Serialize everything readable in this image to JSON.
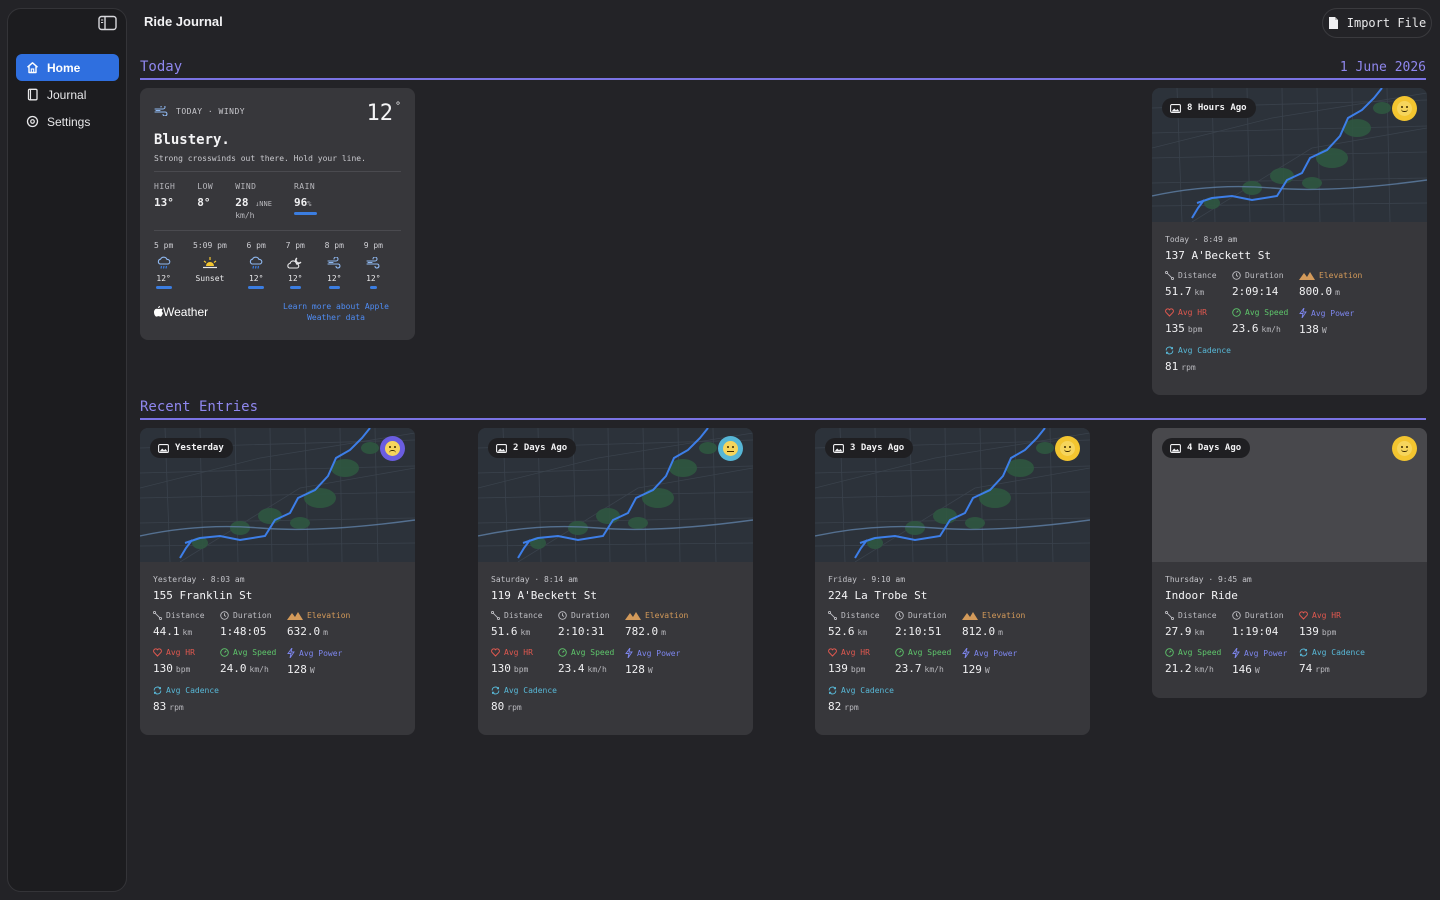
{
  "app": {
    "title": "Ride Journal",
    "import_label": "Import File"
  },
  "sidebar": {
    "items": [
      {
        "label": "Home",
        "icon": "house-icon",
        "active": true
      },
      {
        "label": "Journal",
        "icon": "book-icon",
        "active": false
      },
      {
        "label": "Settings",
        "icon": "gear-icon",
        "active": false
      }
    ]
  },
  "today": {
    "heading": "Today",
    "date": "1 June 2026"
  },
  "weather": {
    "label": "TODAY · WINDY",
    "temp": "12",
    "deg": "°",
    "headline": "Blustery.",
    "subtitle": "Strong crosswinds out there. Hold your line.",
    "stats": {
      "high_label": "HIGH",
      "high": "13°",
      "low_label": "LOW",
      "low": "8°",
      "wind_label": "WIND",
      "wind": "28",
      "wind_dir": "↓NNE",
      "wind_unit": "km/h",
      "rain_label": "RAIN",
      "rain": "96",
      "rain_unit": "%",
      "rain_fraction": 0.96
    },
    "hours": [
      {
        "time": "5 pm",
        "icon": "rain-icon",
        "value": "12°"
      },
      {
        "time": "5:09 pm",
        "icon": "sunset-icon",
        "value": "Sunset"
      },
      {
        "time": "6 pm",
        "icon": "rain-icon",
        "value": "12°"
      },
      {
        "time": "7 pm",
        "icon": "partly-cloudy-night-icon",
        "value": "12°"
      },
      {
        "time": "8 pm",
        "icon": "wind-icon",
        "value": "12°"
      },
      {
        "time": "9 pm",
        "icon": "wind-icon",
        "value": "12°"
      }
    ],
    "brand": "Weather",
    "link": "Learn more about Apple Weather data"
  },
  "today_ride": {
    "pill": "8 Hours Ago",
    "mood": "happy",
    "mood_color": "#f3c530",
    "date": "Today · 8:49 am",
    "title": "137 A'Beckett St",
    "metrics": [
      {
        "label": "Distance",
        "value": "51.7",
        "unit": "km",
        "kind": "grey"
      },
      {
        "label": "Duration",
        "value": "2:09:14",
        "unit": "",
        "kind": "grey"
      },
      {
        "label": "Elevation",
        "value": "800.0",
        "unit": "m",
        "kind": "elev"
      },
      {
        "label": "Avg HR",
        "value": "135",
        "unit": "bpm",
        "kind": "hr"
      },
      {
        "label": "Avg Speed",
        "value": "23.6",
        "unit": "km/h",
        "kind": "speed"
      },
      {
        "label": "Avg Power",
        "value": "138",
        "unit": "W",
        "kind": "power"
      },
      {
        "label": "Avg Cadence",
        "value": "81",
        "unit": "rpm",
        "kind": "cad"
      }
    ]
  },
  "recent": {
    "heading": "Recent Entries"
  },
  "entries": [
    {
      "pill": "Yesterday",
      "mood": "sad",
      "mood_color": "#6a5de0",
      "date": "Yesterday · 8:03 am",
      "title": "155 Franklin St",
      "metrics": [
        {
          "label": "Distance",
          "value": "44.1",
          "unit": "km",
          "kind": "grey"
        },
        {
          "label": "Duration",
          "value": "1:48:05",
          "unit": "",
          "kind": "grey"
        },
        {
          "label": "Elevation",
          "value": "632.0",
          "unit": "m",
          "kind": "elev"
        },
        {
          "label": "Avg HR",
          "value": "130",
          "unit": "bpm",
          "kind": "hr"
        },
        {
          "label": "Avg Speed",
          "value": "24.0",
          "unit": "km/h",
          "kind": "speed"
        },
        {
          "label": "Avg Power",
          "value": "128",
          "unit": "W",
          "kind": "power"
        },
        {
          "label": "Avg Cadence",
          "value": "83",
          "unit": "rpm",
          "kind": "cad"
        }
      ]
    },
    {
      "pill": "2 Days Ago",
      "mood": "neutral",
      "mood_color": "#56b6d6",
      "date": "Saturday · 8:14 am",
      "title": "119 A'Beckett St",
      "metrics": [
        {
          "label": "Distance",
          "value": "51.6",
          "unit": "km",
          "kind": "grey"
        },
        {
          "label": "Duration",
          "value": "2:10:31",
          "unit": "",
          "kind": "grey"
        },
        {
          "label": "Elevation",
          "value": "782.0",
          "unit": "m",
          "kind": "elev"
        },
        {
          "label": "Avg HR",
          "value": "130",
          "unit": "bpm",
          "kind": "hr"
        },
        {
          "label": "Avg Speed",
          "value": "23.4",
          "unit": "km/h",
          "kind": "speed"
        },
        {
          "label": "Avg Power",
          "value": "128",
          "unit": "W",
          "kind": "power"
        },
        {
          "label": "Avg Cadence",
          "value": "80",
          "unit": "rpm",
          "kind": "cad"
        }
      ]
    },
    {
      "pill": "3 Days Ago",
      "mood": "happy",
      "mood_color": "#f3c530",
      "date": "Friday · 9:10 am",
      "title": "224 La Trobe St",
      "metrics": [
        {
          "label": "Distance",
          "value": "52.6",
          "unit": "km",
          "kind": "grey"
        },
        {
          "label": "Duration",
          "value": "2:10:51",
          "unit": "",
          "kind": "grey"
        },
        {
          "label": "Elevation",
          "value": "812.0",
          "unit": "m",
          "kind": "elev"
        },
        {
          "label": "Avg HR",
          "value": "139",
          "unit": "bpm",
          "kind": "hr"
        },
        {
          "label": "Avg Speed",
          "value": "23.7",
          "unit": "km/h",
          "kind": "speed"
        },
        {
          "label": "Avg Power",
          "value": "129",
          "unit": "W",
          "kind": "power"
        },
        {
          "label": "Avg Cadence",
          "value": "82",
          "unit": "rpm",
          "kind": "cad"
        }
      ]
    },
    {
      "pill": "4 Days Ago",
      "mood": "happy",
      "mood_color": "#f3c530",
      "date": "Thursday · 9:45 am",
      "title": "Indoor Ride",
      "metrics": [
        {
          "label": "Distance",
          "value": "27.9",
          "unit": "km",
          "kind": "grey"
        },
        {
          "label": "Duration",
          "value": "1:19:04",
          "unit": "",
          "kind": "grey"
        },
        {
          "label": "Avg HR",
          "value": "139",
          "unit": "bpm",
          "kind": "hr"
        },
        {
          "label": "Avg Speed",
          "value": "21.2",
          "unit": "km/h",
          "kind": "speed"
        },
        {
          "label": "Avg Power",
          "value": "146",
          "unit": "W",
          "kind": "power"
        },
        {
          "label": "Avg Cadence",
          "value": "74",
          "unit": "rpm",
          "kind": "cad"
        }
      ]
    }
  ]
}
